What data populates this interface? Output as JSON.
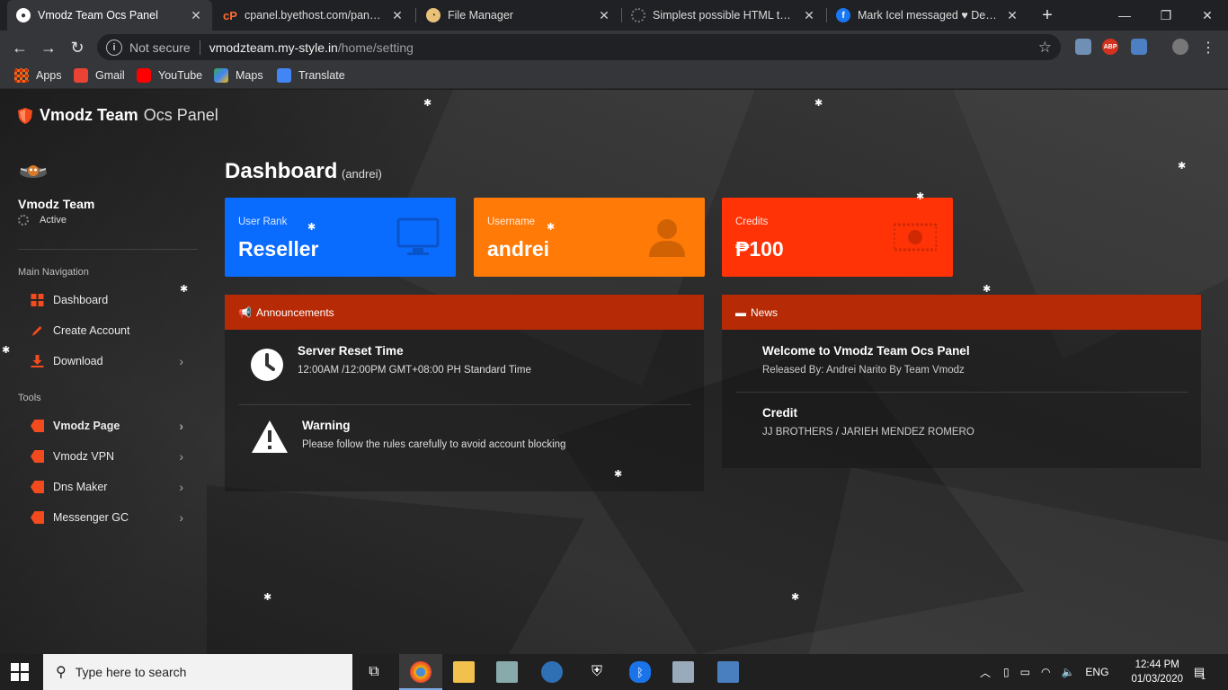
{
  "browser": {
    "tabs": [
      {
        "title": "Vmodz Team Ocs Panel",
        "active": true
      },
      {
        "title": "cpanel.byethost.com/panel/ind",
        "active": false
      },
      {
        "title": "File Manager",
        "active": false
      },
      {
        "title": "Simplest possible HTML templ",
        "active": false
      },
      {
        "title": "Mark Icel messaged ♥ Dev_De",
        "active": false
      }
    ],
    "new_tab": "+",
    "security": "Not secure",
    "url_host": "vmodzteam.my-style.in",
    "url_path": "/home/setting",
    "bookmarks": [
      "Apps",
      "Gmail",
      "YouTube",
      "Maps",
      "Translate"
    ],
    "ext_abp": "ABP"
  },
  "brand": {
    "bold": "Vmodz Team",
    "light": "Ocs Panel"
  },
  "user": {
    "name": "Vmodz Team",
    "status": "Active"
  },
  "sidebar": {
    "main_heading": "Main Navigation",
    "main_items": [
      {
        "label": "Dashboard"
      },
      {
        "label": "Create Account"
      },
      {
        "label": "Download"
      }
    ],
    "tools_heading": "Tools",
    "tools_items": [
      {
        "label": "Vmodz Page"
      },
      {
        "label": "Vmodz VPN"
      },
      {
        "label": "Dns Maker"
      },
      {
        "label": "Messenger GC"
      }
    ]
  },
  "dashboard": {
    "title": "Dashboard",
    "subtitle": "(andrei)",
    "cards": [
      {
        "label": "User Rank",
        "value": "Reseller",
        "color": "#0a6cff",
        "icon": "monitor-icon"
      },
      {
        "label": "Username",
        "value": "andrei",
        "color": "#ff7a07",
        "icon": "user-icon"
      },
      {
        "label": "Credits",
        "value": "₱100",
        "color": "#ff3306",
        "icon": "money-icon"
      }
    ],
    "announcements": {
      "heading": "Announcements",
      "items": [
        {
          "title": "Server Reset Time",
          "text": "12:00AM /12:00PM GMT+08:00 PH Standard Time",
          "icon": "clock-icon"
        },
        {
          "title": "Warning",
          "text": "Please follow the rules carefully to avoid account blocking",
          "icon": "warning-icon"
        }
      ]
    },
    "news": {
      "heading": "News",
      "items": [
        {
          "title": "Welcome to Vmodz Team Ocs Panel",
          "text": "Released By: Andrei Narito By Team Vmodz"
        },
        {
          "title": "Credit",
          "text": "JJ BROTHERS / JARIEH MENDEZ ROMERO"
        }
      ]
    },
    "header_color": "#b72a06"
  },
  "taskbar": {
    "search_placeholder": "Type here to search",
    "lang": "ENG",
    "time": "12:44 PM",
    "date": "01/03/2020",
    "notif_count": "1"
  }
}
